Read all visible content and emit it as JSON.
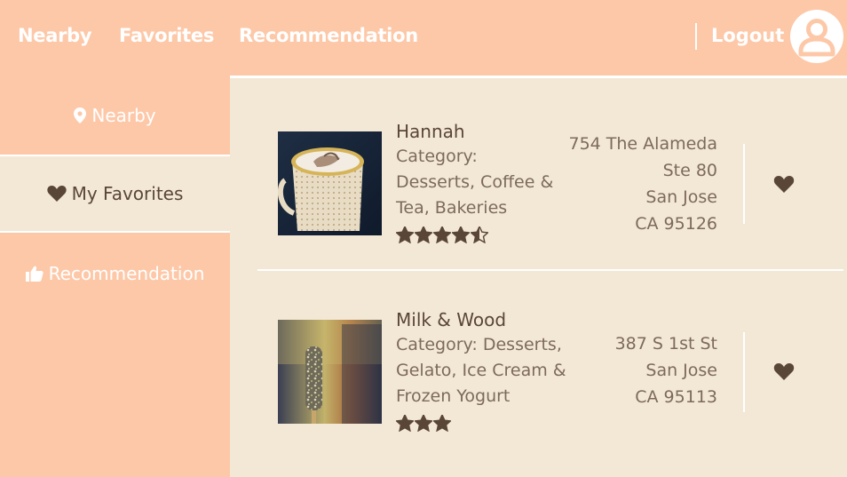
{
  "header": {
    "nav": {
      "nearby": "Nearby",
      "favorites": "Favorites",
      "recommendation": "Recommendation"
    },
    "logout": "Logout",
    "avatar_icon": "user-avatar-icon"
  },
  "sidebar": {
    "items": [
      {
        "label": "Nearby",
        "icon": "map-pin-icon",
        "active": false
      },
      {
        "label": "My Favorites",
        "icon": "heart-icon",
        "active": true
      },
      {
        "label": "Recommendation",
        "icon": "thumbs-up-icon",
        "active": false
      }
    ]
  },
  "restaurants": [
    {
      "name": "Hannah",
      "category": "Category: Desserts, Coffee & Tea, Bakeries",
      "category_lines": [
        "Category:",
        "Desserts, Coffee &",
        "Tea, Bakeries"
      ],
      "rating": 4.5,
      "address_lines": [
        "754 The Alameda",
        "Ste 80",
        "San Jose",
        "CA 95126"
      ],
      "favorite": true
    },
    {
      "name": "Milk & Wood",
      "category": "Category: Desserts, Gelato, Ice Cream & Frozen Yogurt",
      "category_lines": [
        "Category: Desserts,",
        "Gelato, Ice Cream &",
        "Frozen Yogurt"
      ],
      "rating": 3,
      "address_lines": [
        "387 S 1st St",
        "San Jose",
        "CA 95113"
      ],
      "favorite": true
    }
  ],
  "colors": {
    "accent": "#fdc8a8",
    "background": "#f3e8d6",
    "dark_brown": "#5a4636",
    "text": "#7d6a5a"
  }
}
